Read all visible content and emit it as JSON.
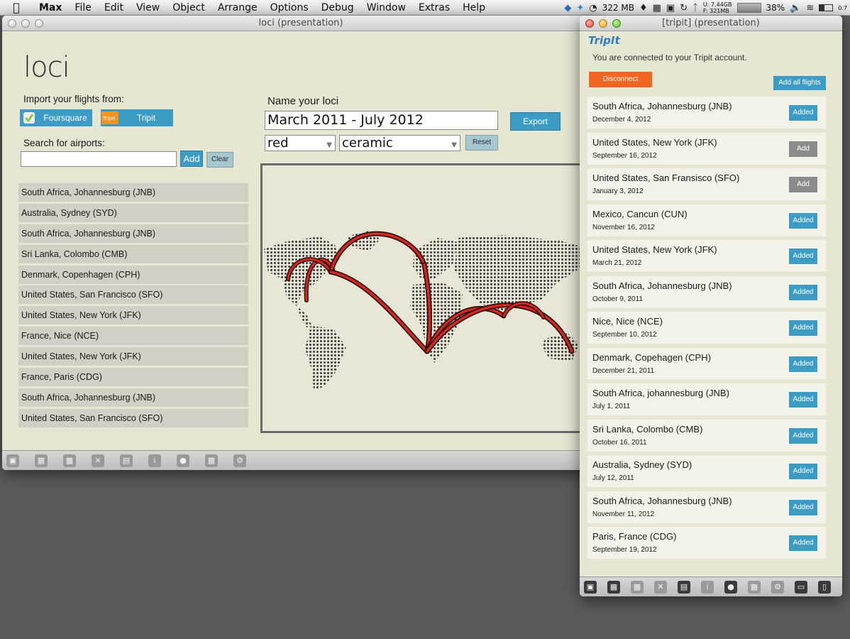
{
  "menubar": {
    "app": "Max",
    "items": [
      "File",
      "Edit",
      "View",
      "Object",
      "Arrange",
      "Options",
      "Debug",
      "Window",
      "Extras",
      "Help"
    ],
    "memory": "322 MB",
    "disk_used": "U: 7.44GB",
    "disk_free": "F: 321MB",
    "battery": "38%",
    "extra": "0.7"
  },
  "loci_window": {
    "title": "loci (presentation)",
    "logo": "loci",
    "import_label": "Import your flights from:",
    "foursquare_label": "Foursquare",
    "tripit_label": "Tripit",
    "search_label": "Search for airports:",
    "search_value": "",
    "add_label": "Add",
    "clear_label": "Clear",
    "name_label": "Name your loci",
    "name_value": "March 2011 - July 2012",
    "export_label": "Export",
    "color_select": "red",
    "material_select": "ceramic",
    "reset_label": "Reset",
    "airports": [
      "South Africa, Johannesburg (JNB)",
      "Australia, Sydney (SYD)",
      "South Africa, Johannesburg (JNB)",
      "Sri Lanka, Colombo (CMB)",
      "Denmark, Copenhagen (CPH)",
      "United States, San Francisco (SFO)",
      "United States, New York (JFK)",
      "France, Nice (NCE)",
      "United States, New York (JFK)",
      "France, Paris (CDG)",
      "South Africa, Johannesburg (JNB)",
      "United States, San Francisco (SFO)"
    ]
  },
  "tripit_window": {
    "title": "[tripit] (presentation)",
    "logo": "TripIt",
    "connected": "You are connected to your Tripit account.",
    "disconnect_label": "Disconnect",
    "add_all_label": "Add all flights",
    "trips": [
      {
        "dest": "South Africa, Johannesburg (JNB)",
        "date": "December 4, 2012",
        "status": "Added"
      },
      {
        "dest": "United States, New York (JFK)",
        "date": "September 16, 2012",
        "status": "Add"
      },
      {
        "dest": "United States, San Fransisco (SFO)",
        "date": "January 3, 2012",
        "status": "Add"
      },
      {
        "dest": "Mexico, Cancun (CUN)",
        "date": "November 16, 2012",
        "status": "Added"
      },
      {
        "dest": "United States, New York (JFK)",
        "date": "March 21, 2012",
        "status": "Added"
      },
      {
        "dest": "South Africa, Johannesburg (JNB)",
        "date": "October 9, 2011",
        "status": "Added"
      },
      {
        "dest": "Nice, Nice (NCE)",
        "date": "September 10, 2012",
        "status": "Added"
      },
      {
        "dest": "Denmark, Copehagen (CPH)",
        "date": "December 21, 2011",
        "status": "Added"
      },
      {
        "dest": "South Africa, johannesburg (JNB)",
        "date": "July 1, 2011",
        "status": "Added"
      },
      {
        "dest": "Sri Lanka, Colombo (CMB)",
        "date": "October 16, 2011",
        "status": "Added"
      },
      {
        "dest": "Australia, Sydney (SYD)",
        "date": "July 12, 2011",
        "status": "Added"
      },
      {
        "dest": "South Africa, Johannesburg (JNB)",
        "date": "November 11, 2012",
        "status": "Added"
      },
      {
        "dest": "Paris, France (CDG)",
        "date": "September 19, 2012",
        "status": "Added"
      }
    ]
  },
  "colors": {
    "accent_blue": "#3c9cc6",
    "disconnect_orange": "#f26522",
    "panel_bg": "#e7e6d3",
    "arc_red": "#d7261d"
  },
  "icons": [
    "apple-icon",
    "dropbox-icon",
    "twitter-icon",
    "bell-icon",
    "bluetooth-icon",
    "wifi-icon",
    "volume-icon",
    "time-machine-icon",
    "foursquare-icon",
    "tripit-icon",
    "lock-icon"
  ]
}
